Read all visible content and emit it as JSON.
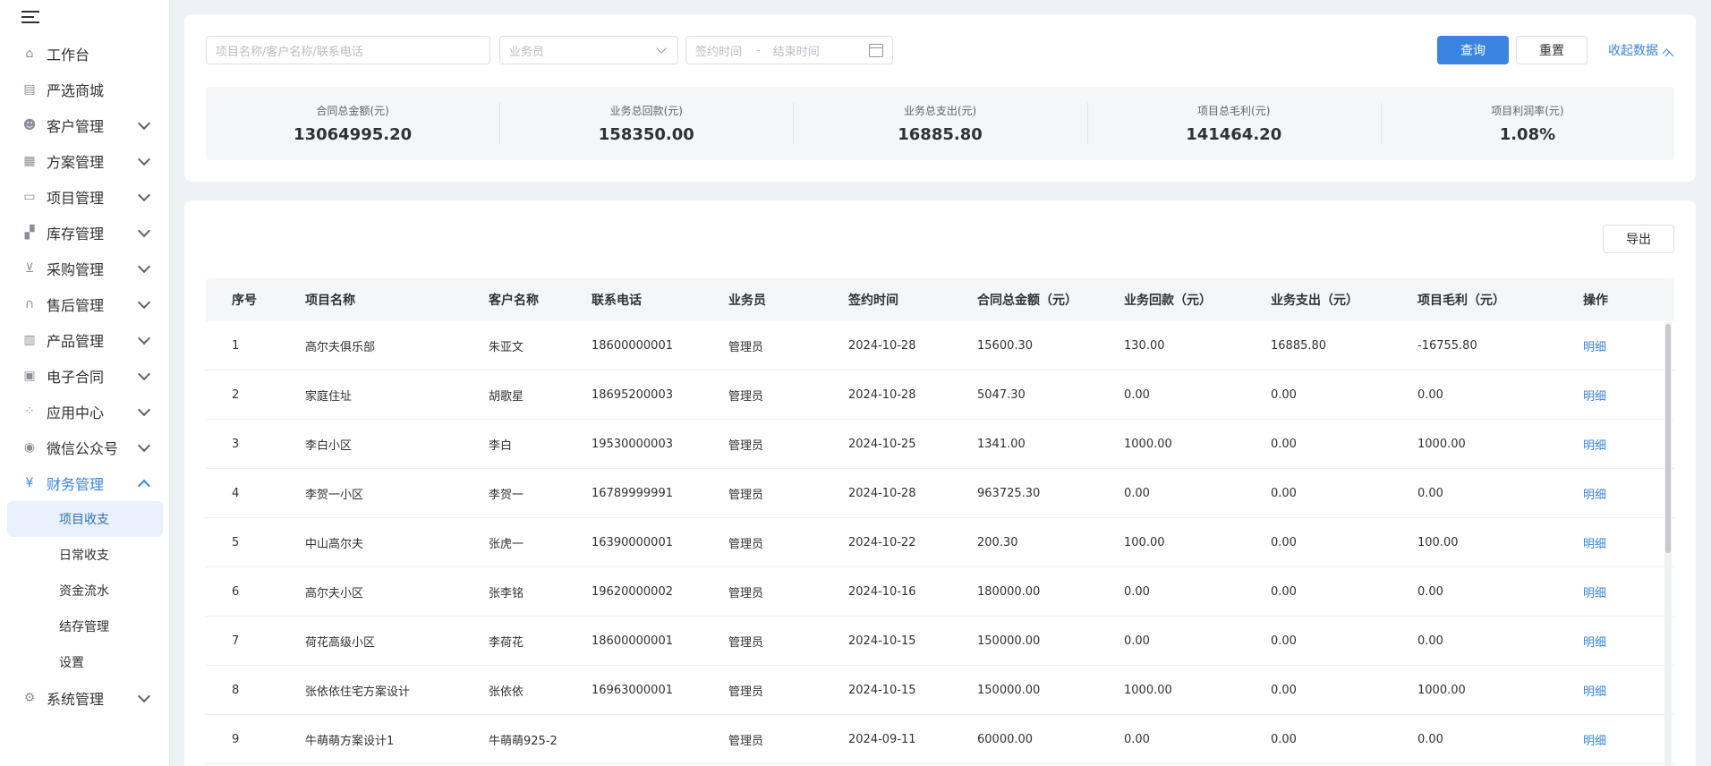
{
  "sidebar": {
    "items": [
      {
        "label": "工作台",
        "icon": "home-icon",
        "glyph": "⌂",
        "chevron": false
      },
      {
        "label": "严选商城",
        "icon": "mall-icon",
        "glyph": "▤",
        "chevron": false
      },
      {
        "label": "客户管理",
        "icon": "customer-icon",
        "glyph": "☻",
        "chevron": true
      },
      {
        "label": "方案管理",
        "icon": "plan-icon",
        "glyph": "▦",
        "chevron": true
      },
      {
        "label": "项目管理",
        "icon": "folder-icon",
        "glyph": "▭",
        "chevron": true
      },
      {
        "label": "库存管理",
        "icon": "inventory-icon",
        "glyph": "▞",
        "chevron": true
      },
      {
        "label": "采购管理",
        "icon": "cart-icon",
        "glyph": "⊻",
        "chevron": true
      },
      {
        "label": "售后管理",
        "icon": "headset-icon",
        "glyph": "∩",
        "chevron": true
      },
      {
        "label": "产品管理",
        "icon": "product-icon",
        "glyph": "▥",
        "chevron": true
      },
      {
        "label": "电子合同",
        "icon": "contract-icon",
        "glyph": "▣",
        "chevron": true
      },
      {
        "label": "应用中心",
        "icon": "apps-icon",
        "glyph": "⁘",
        "chevron": true
      },
      {
        "label": "微信公众号",
        "icon": "wechat-icon",
        "glyph": "◉",
        "chevron": true
      },
      {
        "label": "财务管理",
        "icon": "finance-icon",
        "glyph": "¥",
        "chevron": true,
        "open": true
      }
    ],
    "finance_sub": [
      "项目收支",
      "日常收支",
      "资金流水",
      "结存管理",
      "设置"
    ],
    "finance_active": "项目收支",
    "last_item": {
      "label": "系统管理",
      "icon": "settings-icon",
      "glyph": "⚙"
    }
  },
  "filters": {
    "search_placeholder": "项目名称/客户名称/联系电话",
    "staff_placeholder": "业务员",
    "date_start_placeholder": "签约时间",
    "date_sep": "-",
    "date_end_placeholder": "结束时间",
    "query_label": "查询",
    "reset_label": "重置",
    "collapse_label": "收起数据"
  },
  "stats": [
    {
      "title": "合同总金额(元)",
      "value": "13064995.20"
    },
    {
      "title": "业务总回款(元)",
      "value": "158350.00"
    },
    {
      "title": "业务总支出(元)",
      "value": "16885.80"
    },
    {
      "title": "项目总毛利(元)",
      "value": "141464.20"
    },
    {
      "title": "项目利润率(元)",
      "value": "1.08%"
    }
  ],
  "table": {
    "export_label": "导出",
    "headers": [
      "序号",
      "项目名称",
      "客户名称",
      "联系电话",
      "业务员",
      "签约时间",
      "合同总金额（元）",
      "业务回款（元）",
      "业务支出（元）",
      "项目毛利（元）",
      "操作"
    ],
    "rows": [
      [
        "1",
        "高尔夫俱乐部",
        "朱亚文",
        "18600000001",
        "管理员",
        "2024-10-28",
        "15600.30",
        "130.00",
        "16885.80",
        "-16755.80",
        "明细"
      ],
      [
        "2",
        "家庭住址",
        "胡歌星",
        "18695200003",
        "管理员",
        "2024-10-28",
        "5047.30",
        "0.00",
        "0.00",
        "0.00",
        "明细"
      ],
      [
        "3",
        "李白小区",
        "李白",
        "19530000003",
        "管理员",
        "2024-10-25",
        "1341.00",
        "1000.00",
        "0.00",
        "1000.00",
        "明细"
      ],
      [
        "4",
        "李贺一小区",
        "李贺一",
        "16789999991",
        "管理员",
        "2024-10-28",
        "963725.30",
        "0.00",
        "0.00",
        "0.00",
        "明细"
      ],
      [
        "5",
        "中山高尔夫",
        "张虎一",
        "16390000001",
        "管理员",
        "2024-10-22",
        "200.30",
        "100.00",
        "0.00",
        "100.00",
        "明细"
      ],
      [
        "6",
        "高尔夫小区",
        "张李铭",
        "19620000002",
        "管理员",
        "2024-10-16",
        "180000.00",
        "0.00",
        "0.00",
        "0.00",
        "明细"
      ],
      [
        "7",
        "荷花高级小区",
        "李荷花",
        "18600000001",
        "管理员",
        "2024-10-15",
        "150000.00",
        "0.00",
        "0.00",
        "0.00",
        "明细"
      ],
      [
        "8",
        "张依依住宅方案设计",
        "张依依",
        "16963000001",
        "管理员",
        "2024-10-15",
        "150000.00",
        "1000.00",
        "0.00",
        "1000.00",
        "明细"
      ],
      [
        "9",
        "牛萌萌方案设计1",
        "牛萌萌925-2",
        "",
        "管理员",
        "2024-09-11",
        "60000.00",
        "0.00",
        "0.00",
        "0.00",
        "明细"
      ]
    ]
  },
  "colors": {
    "accent": "#3a84e0",
    "background": "#eef1f6"
  }
}
